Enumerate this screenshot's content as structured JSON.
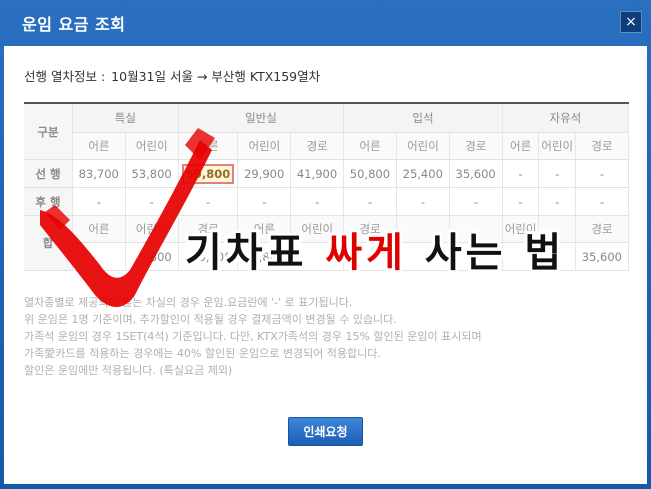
{
  "window": {
    "title": "운임 요금 조회",
    "close_label": "×"
  },
  "train_info": {
    "label": "선행 열차정보 :",
    "value": "10월31일 서울  →  부산행 KTX159열차"
  },
  "table": {
    "corner": "구분",
    "groups": [
      "특실",
      "일반실",
      "입석",
      "자유석"
    ],
    "subheaders": [
      "어른",
      "어린이",
      "어른",
      "어린이",
      "경로",
      "어른",
      "어린이",
      "경로",
      "어른",
      "어린이",
      "경로"
    ],
    "rows": [
      {
        "label": "선 행",
        "cells": [
          "83,700",
          "53,800",
          "",
          "59,800",
          "29,900",
          "41,900",
          "50,800",
          "25,400",
          "35,600",
          "-",
          "-",
          "-"
        ]
      },
      {
        "label": "후 행",
        "cells": [
          "-",
          "-",
          "-",
          "-",
          "-",
          "-",
          "-",
          "-",
          "-",
          "-",
          "-"
        ]
      },
      {
        "label": "합",
        "subcells": [
          "어른",
          "어린이",
          "경로",
          "어른",
          "어린이",
          "경로",
          "",
          "",
          "",
          "어린이",
          "",
          "경로"
        ],
        "cells": [
          "",
          "800",
          "65,800",
          "59,800",
          "",
          "",
          "",
          "",
          "",
          "",
          "35,600"
        ]
      }
    ],
    "highlight": "59,800"
  },
  "notes": [
    {
      "pre": "열차종별로 제공되지 않는 차실의 경우 운임.요금란에 '",
      "dash": "-",
      "post": "' 로 표기됩니다."
    },
    {
      "pre": "위 운임은 1명 기준이며, 추가할인이 적용될 경우 결제금액이 변경될 수 있습니다.",
      "dash": "",
      "post": ""
    },
    {
      "pre": "가족석 운임의 경우 1SET(4석) 기준입니다. 다만, KTX가족석의 경우 15% 할인된 운임이 표시되며",
      "dash": "",
      "post": ""
    },
    {
      "pre": "가족愛카드를 적용하는 경우에는 40% 할인된 운임으로 변경되어 적용합니다.",
      "dash": "",
      "post": ""
    },
    {
      "pre": "할인은 운임에만 적용됩니다. (특실요금 제외)",
      "dash": "",
      "post": ""
    }
  ],
  "print_button": "인쇄요청",
  "overlay": {
    "part1": "기차표 ",
    "part2": "싸게",
    "part3": " 사는 법",
    "accent": "#e00000"
  }
}
